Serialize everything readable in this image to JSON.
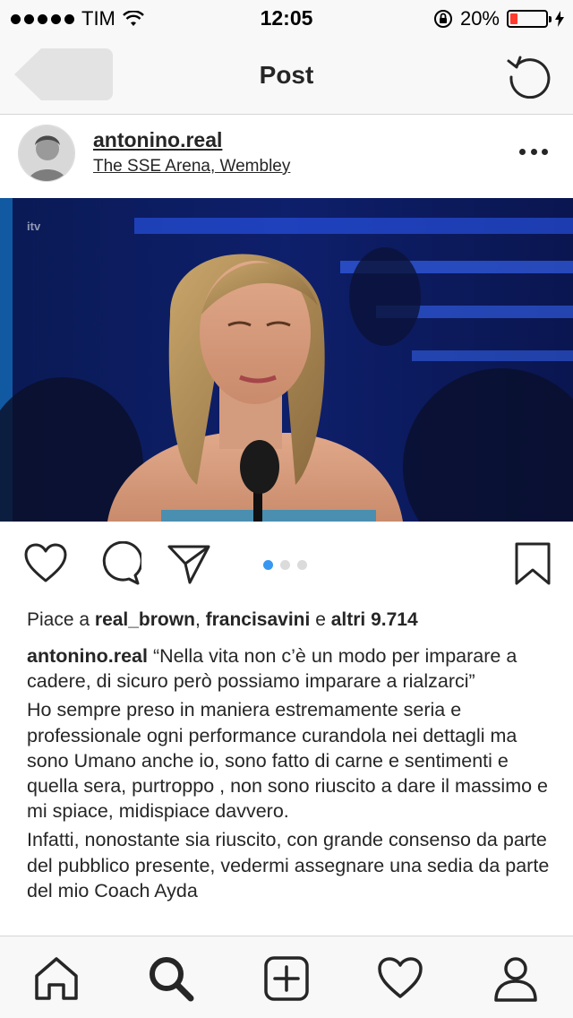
{
  "status_bar": {
    "carrier": "TIM",
    "time": "12:05",
    "battery_percent": "20%",
    "battery_level": 0.2,
    "battery_color": "#ff3b30"
  },
  "nav": {
    "title": "Post",
    "back_icon": "back-arrow-icon",
    "refresh_icon": "refresh-icon"
  },
  "post": {
    "username": "antonino.real",
    "location": "The SSE Arena, Wembley",
    "media_overlay": "itv",
    "carousel": {
      "count": 3,
      "active_index": 0,
      "active_color": "#3897f0",
      "inactive_color": "#dbdbdb"
    },
    "likes": {
      "prefix": "Piace a",
      "user1": "real_brown",
      "sep": ",",
      "user2": "francisavini",
      "conj": "e",
      "others": "altri 9.714"
    },
    "caption": {
      "user": "antonino.real",
      "quote": "“Nella vita non c’è un modo per imparare a cadere, di sicuro però possiamo imparare a rialzarci”",
      "paragraph1": "Ho sempre preso in maniera estremamente seria e professionale ogni performance curandola nei dettagli ma sono Umano anche io, sono fatto di carne  e sentimenti e quella sera, purtroppo , non sono riuscito a dare il massimo e mi spiace, midispiace davvero.",
      "paragraph2": "Infatti, nonostante sia riuscito, con grande consenso da parte del pubblico presente, vedermi assegnare una sedia da parte del mio Coach Ayda"
    }
  },
  "tab_bar": {
    "items": [
      "home-icon",
      "search-icon",
      "add-post-icon",
      "activity-heart-icon",
      "profile-icon"
    ]
  }
}
